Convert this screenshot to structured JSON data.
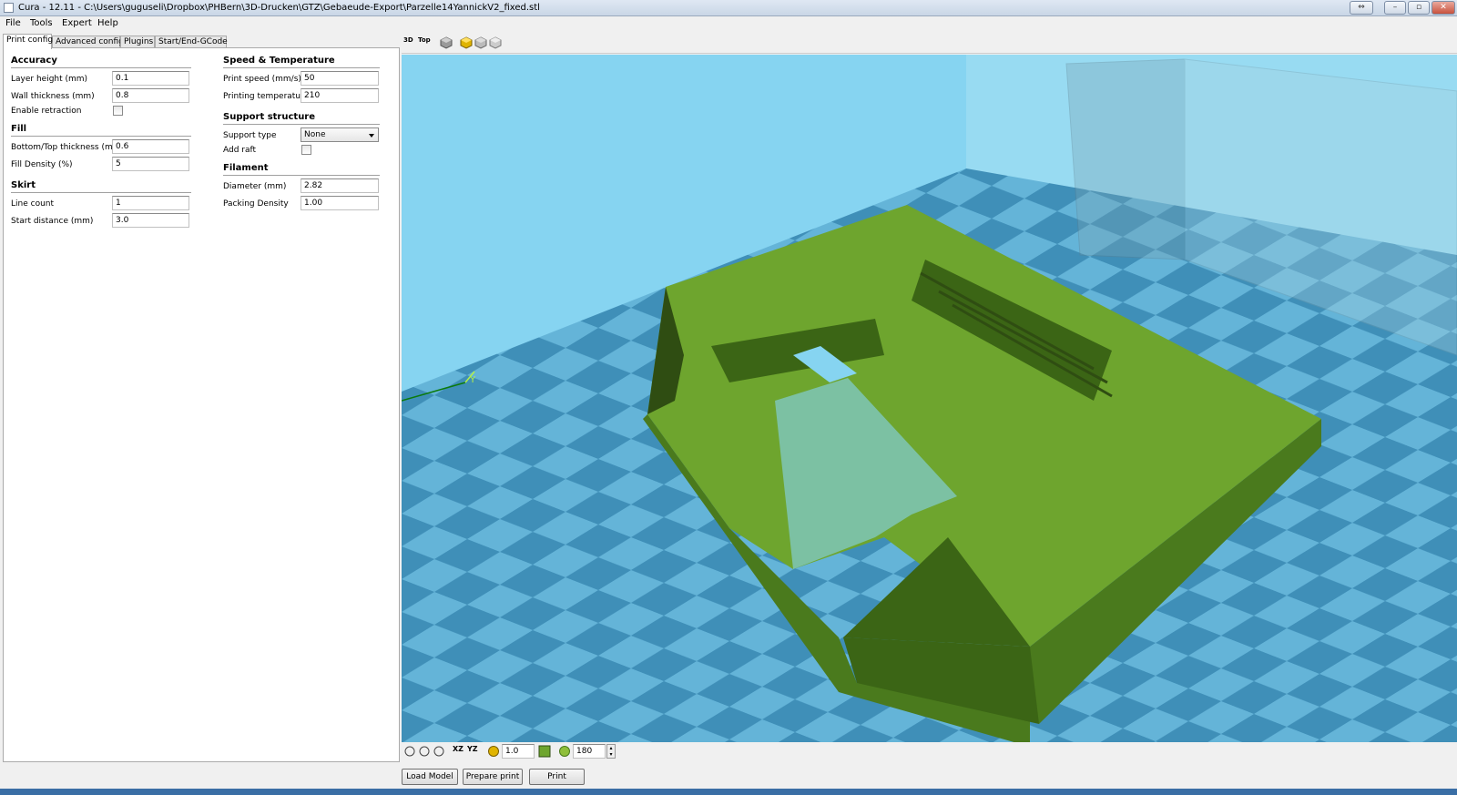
{
  "window": {
    "title": "Cura - 12.11 - C:\\Users\\guguseli\\Dropbox\\PHBern\\3D-Drucken\\GTZ\\Gebaeude-Export\\Parzelle14YannickV2_fixed.stl",
    "minimize_icon": "minimize-icon",
    "maximize_icon": "maximize-icon",
    "close_icon": "close-icon"
  },
  "menu": [
    "File",
    "Tools",
    "Expert",
    "Help"
  ],
  "tabs": [
    "Print config",
    "Advanced config",
    "Plugins",
    "Start/End-GCode"
  ],
  "config": {
    "accuracy": {
      "title": "Accuracy",
      "layer_height_label": "Layer height (mm)",
      "layer_height": "0.1",
      "wall_thickness_label": "Wall thickness (mm)",
      "wall_thickness": "0.8",
      "enable_retraction_label": "Enable retraction",
      "enable_retraction": false
    },
    "fill": {
      "title": "Fill",
      "bottom_top_label": "Bottom/Top thickness (mm)",
      "bottom_top": "0.6",
      "fill_density_label": "Fill Density (%)",
      "fill_density": "5"
    },
    "skirt": {
      "title": "Skirt",
      "line_count_label": "Line count",
      "line_count": "1",
      "start_distance_label": "Start distance (mm)",
      "start_distance": "3.0"
    },
    "speed": {
      "title": "Speed & Temperature",
      "print_speed_label": "Print speed (mm/s)",
      "print_speed": "50",
      "printing_temp_label": "Printing temperature",
      "printing_temp": "210"
    },
    "support": {
      "title": "Support structure",
      "support_type_label": "Support type",
      "support_type": "None",
      "add_raft_label": "Add raft",
      "add_raft": false
    },
    "filament": {
      "title": "Filament",
      "diameter_label": "Diameter (mm)",
      "diameter": "2.82",
      "packing_density_label": "Packing Density",
      "packing_density": "1.00"
    }
  },
  "viewport": {
    "view_buttons": [
      "3D",
      "Top"
    ],
    "scale_value": "1.0",
    "rotate_value": "180",
    "mirror_buttons": [
      "XZ",
      "YZ"
    ],
    "colors": {
      "sky": "#7fd0ef",
      "bed_dark": "#3f8fb8",
      "bed_light": "#6cb9dc",
      "model": "#6ea52e",
      "model_dark": "#4a7a1d",
      "model_shadow": "#2f4d12"
    }
  },
  "actions": {
    "load_model": "Load Model",
    "prepare_print": "Prepare print",
    "print": "Print"
  }
}
